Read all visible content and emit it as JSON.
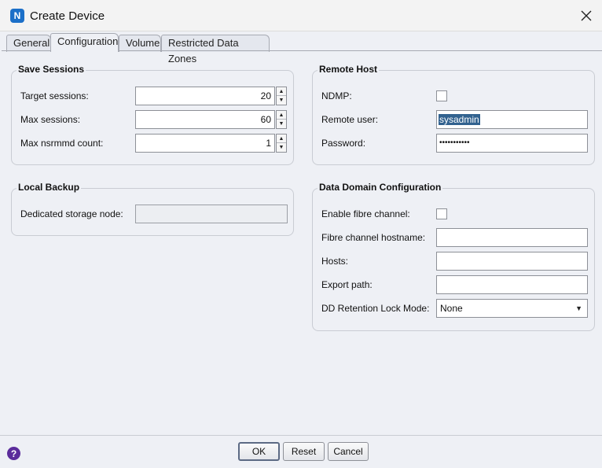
{
  "window": {
    "title": "Create Device",
    "app_icon_letter": "N"
  },
  "tabs": [
    {
      "label": "General",
      "active": false
    },
    {
      "label": "Configuration",
      "active": true
    },
    {
      "label": "Volume",
      "active": false
    },
    {
      "label": "Restricted Data Zones",
      "active": false
    }
  ],
  "save_sessions": {
    "title": "Save Sessions",
    "target_label": "Target sessions:",
    "target_value": "20",
    "max_label": "Max sessions:",
    "max_value": "60",
    "nsrmmd_label": "Max nsrmmd count:",
    "nsrmmd_value": "1"
  },
  "remote_host": {
    "title": "Remote Host",
    "ndmp_label": "NDMP:",
    "user_label": "Remote user:",
    "user_value": "sysadmin",
    "password_label": "Password:",
    "password_mask": "•••••••••••"
  },
  "local_backup": {
    "title": "Local Backup",
    "storage_node_label": "Dedicated storage node:",
    "storage_node_value": ""
  },
  "data_domain": {
    "title": "Data Domain Configuration",
    "fibre_label": "Enable fibre channel:",
    "hostname_label": "Fibre channel hostname:",
    "hostname_value": "",
    "hosts_label": "Hosts:",
    "hosts_value": "",
    "export_label": "Export path:",
    "export_value": "",
    "retention_label": "DD Retention Lock Mode:",
    "retention_value": "None"
  },
  "buttons": {
    "ok": "OK",
    "reset": "Reset",
    "cancel": "Cancel"
  },
  "icons": {
    "close": "close-icon",
    "help": "help-icon",
    "app": "networker-app-icon"
  },
  "colors": {
    "selection": "#32628f",
    "help": "#5b2c9b",
    "app": "#1b6fc8"
  }
}
